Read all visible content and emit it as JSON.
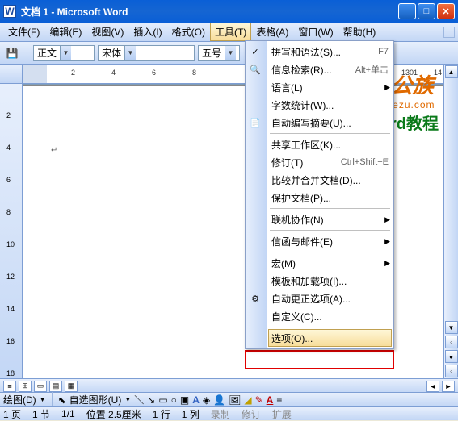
{
  "titlebar": {
    "title": "文档 1 - Microsoft Word"
  },
  "menubar": {
    "items": [
      "文件(F)",
      "编辑(E)",
      "视图(V)",
      "插入(I)",
      "格式(O)",
      "工具(T)",
      "表格(A)",
      "窗口(W)",
      "帮助(H)"
    ],
    "open_index": 5
  },
  "toolbar": {
    "style_combo": "正文",
    "font_combo": "宋体",
    "size_combo": "五号"
  },
  "dropdown": {
    "items": [
      {
        "label": "拼写和语法(S)...",
        "shortcut": "F7",
        "icon": "✓"
      },
      {
        "label": "信息检索(R)...",
        "shortcut": "Alt+单击",
        "icon": "🔍"
      },
      {
        "label": "语言(L)",
        "submenu": true
      },
      {
        "label": "字数统计(W)..."
      },
      {
        "label": "自动编写摘要(U)...",
        "icon": "📄"
      },
      {
        "sep": true
      },
      {
        "label": "共享工作区(K)..."
      },
      {
        "label": "修订(T)",
        "shortcut": "Ctrl+Shift+E"
      },
      {
        "label": "比较并合并文档(D)..."
      },
      {
        "label": "保护文档(P)..."
      },
      {
        "sep": true
      },
      {
        "label": "联机协作(N)",
        "submenu": true
      },
      {
        "sep": true
      },
      {
        "label": "信函与邮件(E)",
        "submenu": true
      },
      {
        "sep": true
      },
      {
        "label": "宏(M)",
        "submenu": true
      },
      {
        "label": "模板和加载项(I)..."
      },
      {
        "label": "自动更正选项(A)...",
        "icon": "⚙"
      },
      {
        "label": "自定义(C)..."
      },
      {
        "sep": true
      },
      {
        "label": "选项(O)...",
        "highlight": true
      }
    ]
  },
  "ruler": {
    "labels": [
      "2",
      "4",
      "6",
      "8"
    ],
    "right_labels": [
      "1301",
      "14"
    ]
  },
  "vruler": {
    "labels": [
      "2",
      "4",
      "6",
      "8",
      "10",
      "12",
      "14",
      "16",
      "18"
    ]
  },
  "drawbar": {
    "label": "绘图(D)",
    "autoshape": "自选图形(U)"
  },
  "statusbar": {
    "page": "1 页",
    "section": "1 节",
    "pages": "1/1",
    "pos": "位置 2.5厘米",
    "line": "1 行",
    "col": "1 列",
    "modes": [
      "录制",
      "修订",
      "扩展"
    ]
  },
  "watermark": {
    "l1": "办公族",
    "l2": "Officezu.com",
    "l3": "Word教程"
  }
}
